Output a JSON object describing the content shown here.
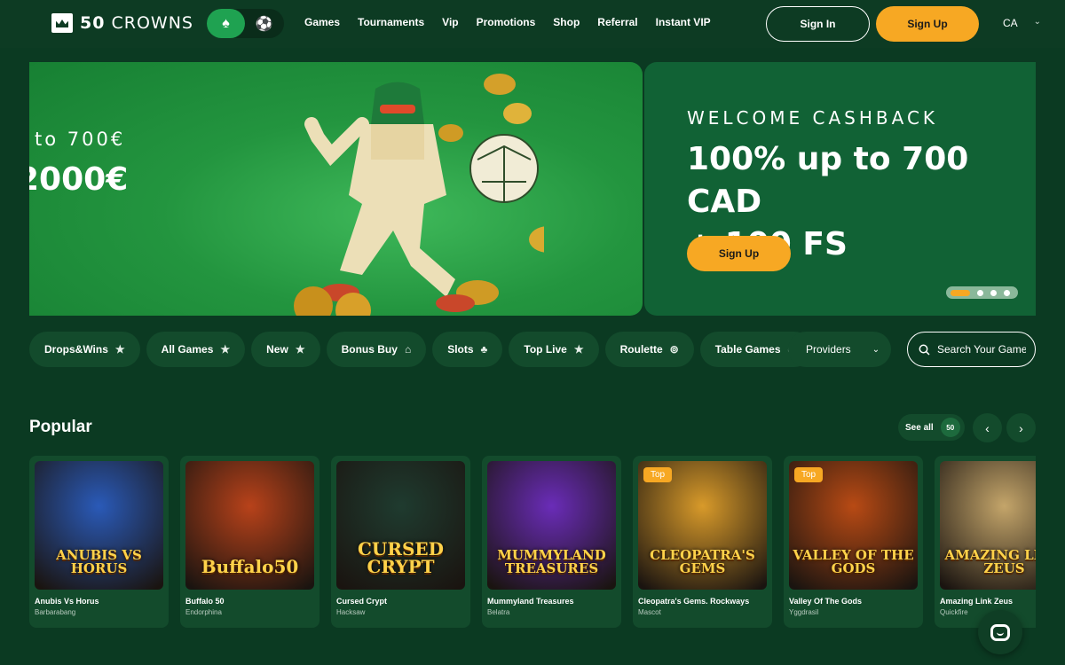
{
  "header": {
    "logo_number": "50",
    "logo_word": "CROWNS",
    "mode_casino_icon": "spade-icon",
    "mode_sport_icon": "soccer-ball-icon",
    "nav": [
      "Games",
      "Tournaments",
      "Vip",
      "Promotions",
      "Shop",
      "Referral",
      "Instant VIP"
    ],
    "sign_in": "Sign In",
    "sign_up": "Sign Up",
    "language": "CA"
  },
  "banners": {
    "left": {
      "line1": "to 700€",
      "line2": "2000€"
    },
    "right": {
      "kicker": "WELCOME CASHBACK",
      "title_line1": "100% up to 700 CAD",
      "title_line2": "+ 100 FS",
      "cta": "Sign Up"
    },
    "carousel_active_index": 0,
    "carousel_count": 4
  },
  "filters": [
    {
      "label": "Drops&Wins",
      "icon": "star-icon",
      "glyph": "★"
    },
    {
      "label": "All Games",
      "icon": "star-icon",
      "glyph": "★"
    },
    {
      "label": "New",
      "icon": "star-icon",
      "glyph": "★"
    },
    {
      "label": "Bonus Buy",
      "icon": "gift-icon",
      "glyph": "⌂"
    },
    {
      "label": "Slots",
      "icon": "cherries-icon",
      "glyph": "♣"
    },
    {
      "label": "Top Live",
      "icon": "star-icon",
      "glyph": "★"
    },
    {
      "label": "Roulette",
      "icon": "roulette-icon",
      "glyph": "⊚"
    },
    {
      "label": "Table Games",
      "icon": "chip-icon",
      "glyph": "◎"
    }
  ],
  "providers_label": "Providers",
  "search": {
    "placeholder": "Search Your Games"
  },
  "popular": {
    "title": "Popular",
    "see_all": "See all",
    "count": "50",
    "games": [
      {
        "name": "Anubis Vs Horus",
        "provider": "Barbarabang",
        "thumb_title": "ANUBIS VS HORUS",
        "top": false,
        "bg": "#2a5ab8"
      },
      {
        "name": "Buffalo 50",
        "provider": "Endorphina",
        "thumb_title": "Buffalo50",
        "top": false,
        "bg": "#b8421a"
      },
      {
        "name": "Cursed Crypt",
        "provider": "Hacksaw",
        "thumb_title": "CURSED CRYPT",
        "top": false,
        "bg": "#1f3b2f"
      },
      {
        "name": "Mummyland Treasures",
        "provider": "Belatra",
        "thumb_title": "MUMMYLAND TREASURES",
        "top": false,
        "bg": "#6a2cb8"
      },
      {
        "name": "Cleopatra's Gems. Rockways",
        "provider": "Mascot",
        "thumb_title": "CLEOPATRA'S GEMS",
        "top": true,
        "top_label": "Top",
        "bg": "#d89a2a"
      },
      {
        "name": "Valley Of The Gods",
        "provider": "Yggdrasil",
        "thumb_title": "VALLEY OF THE GODS",
        "top": true,
        "top_label": "Top",
        "bg": "#b84a14"
      },
      {
        "name": "Amazing Link Zeus",
        "provider": "Quickfire",
        "thumb_title": "AMAZING LINK ZEUS",
        "top": false,
        "bg": "#c4a56a"
      }
    ]
  },
  "chat_icon": "chat-icon",
  "colors": {
    "background": "#0b3a22",
    "accent": "#f7a823",
    "active_mode": "#1fa251",
    "chip": "#134b2c"
  }
}
